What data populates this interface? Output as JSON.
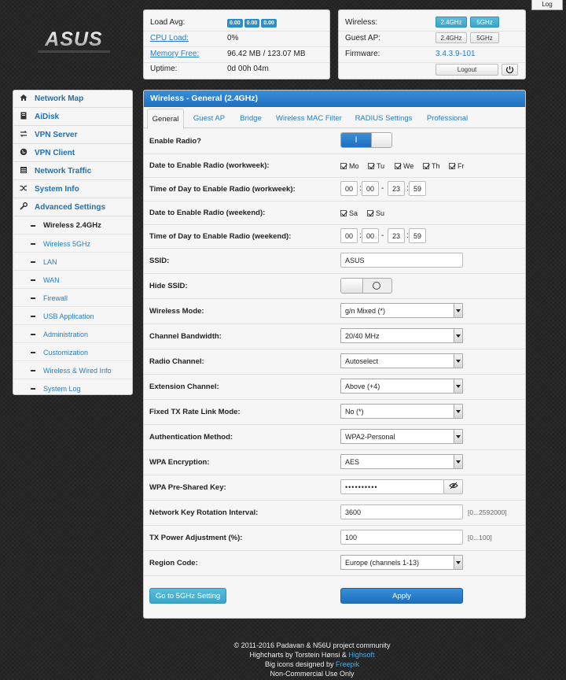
{
  "top": {
    "log_label": "Log",
    "logo_text": "ASUS"
  },
  "status": {
    "load_label": "Load Avg:",
    "load_values": [
      "0.00",
      "0.00",
      "0.00"
    ],
    "cpu_label": "CPU Load:",
    "cpu_value": "0%",
    "mem_label": "Memory Free:",
    "mem_value": "96.42 MB / 123.07 MB",
    "uptime_label": "Uptime:",
    "uptime_value": "0d 00h 04m"
  },
  "wireless_info": {
    "wireless_label": "Wireless:",
    "guest_label": "Guest AP:",
    "firmware_label": "Firmware:",
    "firmware_value": "3.4.3.9-101",
    "band_24": "2.4GHz",
    "band_5": "5GHz",
    "logout_label": "Logout",
    "power_icon": "power-icon"
  },
  "sidebar": {
    "items": [
      {
        "label": "Network Map",
        "icon": "home-icon"
      },
      {
        "label": "AiDisk",
        "icon": "disk-icon"
      },
      {
        "label": "VPN Server",
        "icon": "vpn-server-icon"
      },
      {
        "label": "VPN Client",
        "icon": "globe-icon"
      },
      {
        "label": "Network Traffic",
        "icon": "traffic-icon"
      },
      {
        "label": "System Info",
        "icon": "shuffle-icon"
      },
      {
        "label": "Advanced Settings",
        "icon": "wrench-icon"
      }
    ],
    "subitems": [
      {
        "label": "Wireless 2.4GHz"
      },
      {
        "label": "Wireless 5GHz"
      },
      {
        "label": "LAN"
      },
      {
        "label": "WAN"
      },
      {
        "label": "Firewall"
      },
      {
        "label": "USB Application"
      },
      {
        "label": "Administration"
      },
      {
        "label": "Customization"
      },
      {
        "label": "Wireless & Wired Info"
      },
      {
        "label": "System Log"
      }
    ]
  },
  "main": {
    "title": "Wireless - General (2.4GHz)",
    "tabs": [
      "General",
      "Guest AP",
      "Bridge",
      "Wireless MAC Filter",
      "RADIUS Settings",
      "Professional"
    ],
    "fields": {
      "enable_radio": "Enable Radio?",
      "toggle_on_symbol": "I",
      "date_workweek": "Date to Enable Radio (workweek):",
      "days_workweek": [
        "Mo",
        "Tu",
        "We",
        "Th",
        "Fr"
      ],
      "time_workweek": "Time of Day to Enable Radio (workweek):",
      "time_workweek_values": [
        "00",
        "00",
        "23",
        "59"
      ],
      "date_weekend": "Date to Enable Radio (weekend):",
      "days_weekend": [
        "Sa",
        "Su"
      ],
      "time_weekend": "Time of Day to Enable Radio (weekend):",
      "time_weekend_values": [
        "00",
        "00",
        "23",
        "59"
      ],
      "ssid_label": "SSID:",
      "ssid_value": "ASUS",
      "hide_ssid": "Hide SSID:",
      "mode_label": "Wireless Mode:",
      "mode_value": "g/n Mixed (*)",
      "bw_label": "Channel Bandwidth:",
      "bw_value": "20/40 MHz",
      "chan_label": "Radio Channel:",
      "chan_value": "Autoselect",
      "ext_label": "Extension Channel:",
      "ext_value": "Above (+4)",
      "txrate_label": "Fixed TX Rate Link Mode:",
      "txrate_value": "No (*)",
      "auth_label": "Authentication Method:",
      "auth_value": "WPA2-Personal",
      "enc_label": "WPA Encryption:",
      "enc_value": "AES",
      "psk_label": "WPA Pre-Shared Key:",
      "psk_value": "••••••••••",
      "rot_label": "Network Key Rotation Interval:",
      "rot_value": "3600",
      "rot_hint": "[0...2592000]",
      "txp_label": "TX Power Adjustment (%):",
      "txp_value": "100",
      "txp_hint": "[0...100]",
      "region_label": "Region Code:",
      "region_value": "Europe (channels 1-13)"
    },
    "goto_5g": "Go to 5GHz Setting",
    "apply": "Apply"
  },
  "footer": {
    "line1": "© 2011-2016 Padavan & N56U project community",
    "line2_prefix": "Highcharts by Torstein Hønsi & ",
    "line2_link": "Highsoft",
    "line3_prefix": "Big icons designed by ",
    "line3_link": "Freepik",
    "line4": "Non-Commercial Use Only"
  }
}
